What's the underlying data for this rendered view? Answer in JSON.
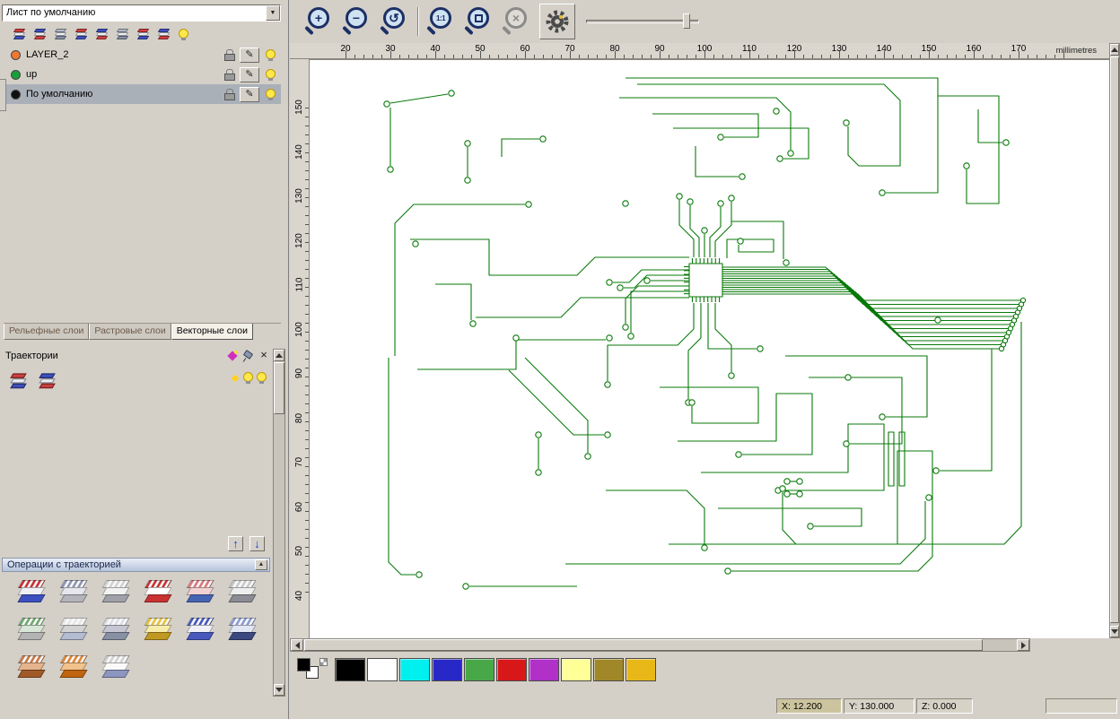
{
  "left_panel": {
    "sheet_selector": {
      "value": "Лист по умолчанию"
    },
    "layers": [
      {
        "name": "LAYER_2",
        "color": "#f07830",
        "selected": false
      },
      {
        "name": "up",
        "color": "#18a038",
        "selected": false
      },
      {
        "name": "По умолчанию",
        "color": "#101010",
        "selected": true
      }
    ],
    "tabs": [
      {
        "label": "Рельефные слои",
        "active": false
      },
      {
        "label": "Растровые слои",
        "active": false
      },
      {
        "label": "Векторные слои",
        "active": true
      }
    ],
    "toolpaths": {
      "title": "Траектории",
      "operations_title": "Операции с траекторией"
    }
  },
  "toolbar": {
    "zoom_1to1_label": "1:1"
  },
  "rulers": {
    "units_label": "millimetres",
    "horizontal_ticks": [
      "20",
      "30",
      "40",
      "50",
      "60",
      "70",
      "80",
      "90",
      "100",
      "110",
      "120",
      "130",
      "140",
      "150",
      "160",
      "170"
    ],
    "vertical_ticks": [
      "150",
      "140",
      "130",
      "120",
      "110",
      "100",
      "90",
      "80",
      "70",
      "60",
      "50",
      "40"
    ]
  },
  "canvas": {
    "content": "PCB circuit board vector artwork",
    "trace_color": "#0a7a0a"
  },
  "palette": {
    "swatches": [
      {
        "name": "black",
        "color": "#000000"
      },
      {
        "name": "white",
        "color": "#ffffff"
      },
      {
        "name": "cyan",
        "color": "#00f0f0"
      },
      {
        "name": "blue",
        "color": "#2828c8"
      },
      {
        "name": "green",
        "color": "#48a848"
      },
      {
        "name": "red",
        "color": "#d81818"
      },
      {
        "name": "magenta",
        "color": "#b030c8"
      },
      {
        "name": "pale-yellow",
        "color": "#ffff98"
      },
      {
        "name": "olive",
        "color": "#a08828"
      },
      {
        "name": "gold",
        "color": "#e8b818"
      }
    ]
  },
  "statusbar": {
    "x": "X: 12.200",
    "y": "Y: 130.000",
    "z": "Z: 0.000"
  },
  "icons": {
    "close": "×",
    "pencil": "✎",
    "dropdown-arrow": "▼",
    "up-arrow": "↑",
    "down-arrow": "↓",
    "collapse-arrow": "▲",
    "zoom-plus": "+",
    "zoom-minus": "−",
    "zoom-undo": "↺",
    "zoom-cross": "×"
  }
}
